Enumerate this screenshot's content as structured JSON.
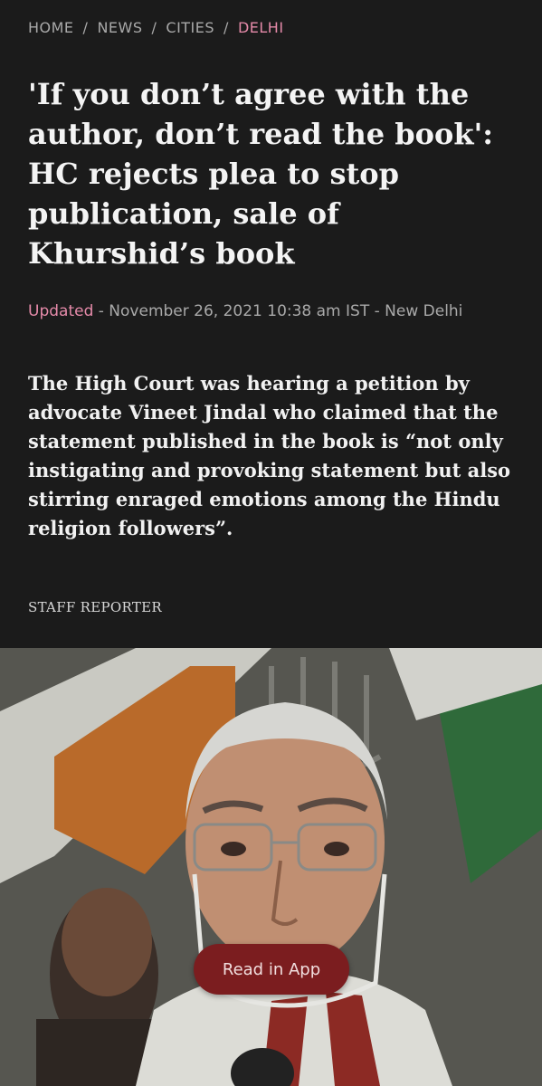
{
  "breadcrumb": {
    "items": [
      "HOME",
      "NEWS",
      "CITIES",
      "DELHI"
    ],
    "separator": "/"
  },
  "article": {
    "headline": "'If you don’t agree with the author, don’t read the book': HC rejects plea to stop publication, sale of Khurshid’s book",
    "meta": {
      "updated_label": "Updated",
      "details": " - November 26, 2021 10:38 am IST - New Delhi"
    },
    "summary": "The High Court was hearing a petition by advocate Vineet Jindal who claimed that the statement published in the book is “not only instigating and provoking statement but also stirring enraged emotions among the Hindu religion followers”.",
    "byline": "STAFF REPORTER"
  },
  "cta": {
    "read_in_app_label": "Read in App"
  },
  "colors": {
    "background": "#1b1b1b",
    "accent_pink": "#e58aa9",
    "cta_background": "#7b1d1f"
  }
}
